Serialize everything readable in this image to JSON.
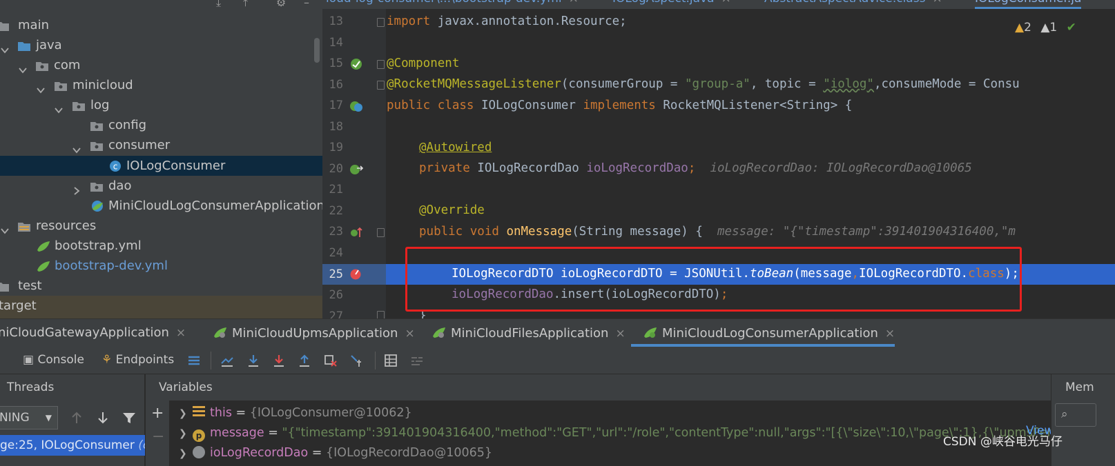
{
  "project_tree": {
    "items": [
      {
        "label": "main"
      },
      {
        "label": "java"
      },
      {
        "label": "com"
      },
      {
        "label": "minicloud"
      },
      {
        "label": "log"
      },
      {
        "label": "config"
      },
      {
        "label": "consumer"
      },
      {
        "label": "IOLogConsumer"
      },
      {
        "label": "dao"
      },
      {
        "label": "MiniCloudLogConsumerApplication"
      },
      {
        "label": "resources"
      },
      {
        "label": "bootstrap.yml"
      },
      {
        "label": "bootstrap-dev.yml"
      },
      {
        "label": "test"
      },
      {
        "label": "target"
      }
    ]
  },
  "editor_tabs": [
    {
      "label": "loud-log-consumer\\...\\bootstrap-dev.yml"
    },
    {
      "label": "IOLogAspect.java"
    },
    {
      "label": "AbstractAspectAdvice.class"
    },
    {
      "label": "IOLogConsumer.ja"
    }
  ],
  "inspections": {
    "warnings": "2",
    "weak_warnings": "1"
  },
  "line_numbers": [
    "13",
    "14",
    "15",
    "16",
    "17",
    "18",
    "19",
    "20",
    "21",
    "22",
    "23",
    "24",
    "25",
    "26",
    "27"
  ],
  "code": {
    "l13_kw": "import",
    "l13_rest": " javax.annotation.Resource;",
    "l15_ann": "@Component",
    "l16_ann": "@RocketMQMessageListener",
    "l16_a": "(consumerGroup = ",
    "l16_s1": "\"group-a\"",
    "l16_b": ", topic = ",
    "l16_s2": "\"iolog\"",
    "l16_c": ",consumeMode = Consu",
    "l17_kw": "public class ",
    "l17_a": "IOLogConsumer ",
    "l17_kw2": "implements ",
    "l17_b": "RocketMQListener<String> {",
    "l19_ann": "@Autowired",
    "l20_kw": "private ",
    "l20_a": "IOLogRecordDao ",
    "l20_fld": "ioLogRecordDao",
    "l20_b": ";",
    "l20_hint": "ioLogRecordDao: IOLogRecordDao@10065",
    "l22_ann": "@Override",
    "l23_kw": "public void ",
    "l23_fn": "onMessage",
    "l23_a": "(String message) {",
    "l23_hint": "message: \"{\"timestamp\":391401904316400,\"m",
    "l25_a": "IOLogRecordDTO ioLogRecordDTO = JSONUtil.",
    "l25_it": "toBean",
    "l25_b": "(message",
    "l25_c": ",",
    "l25_d": "IOLogRecordDTO.",
    "l25_kw": "class",
    "l25_e": ");",
    "l26_fld": "ioLogRecordDao",
    "l26_a": ".insert(ioLogRecordDTO)",
    "l26_b": ";",
    "l27_a": "}"
  },
  "run_tabs": [
    {
      "label": "iniCloudGatewayApplication"
    },
    {
      "label": "MiniCloudUpmsApplication"
    },
    {
      "label": "MiniCloudFilesApplication"
    },
    {
      "label": "MiniCloudLogConsumerApplication"
    }
  ],
  "debug_toolbar": {
    "console": "Console",
    "endpoints": "Endpoints"
  },
  "threads": {
    "header": "Threads",
    "selected": "NING",
    "frame_a": "ge:25, IOLogConsumer ",
    "frame_b": "(c"
  },
  "variables": {
    "header": "Variables",
    "rows": [
      {
        "name": "this",
        "value": "{IOLogConsumer@10062}"
      },
      {
        "name": "message",
        "value": "\"{\"timestamp\":391401904316400,\"method\":\"GET\",\"url\":\"/role\",\"contentType\":null,\"args\":\"[{\\\"size\\\":10,\\\"page\\\":1},{\\\"upmsPerm"
      },
      {
        "name": "ioLogRecordDao",
        "value": "{IOLogRecordDao@10065}"
      }
    ],
    "view_link": "View"
  },
  "memory": {
    "header": "Mem"
  },
  "watermark": "CSDN @峡谷电光马仔",
  "colors": {
    "selection": "#2f65ca",
    "accent": "#4a88c7",
    "breakpoint": "#e34b4b",
    "redbox": "#e8211f"
  }
}
